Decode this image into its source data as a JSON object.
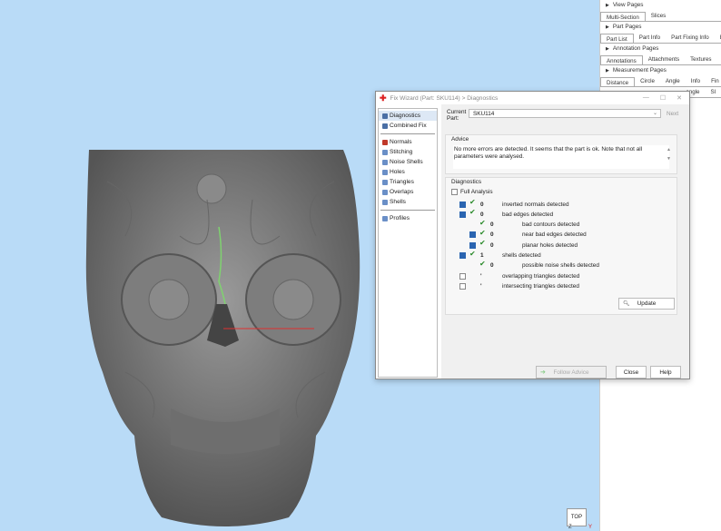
{
  "viewport": {
    "background": "#b9dbf7",
    "top_button": "TOP",
    "axis_z": "Z",
    "axis_y": "Y"
  },
  "right_panel": {
    "sections": [
      {
        "label": "View Pages",
        "tabs": [
          {
            "label": "Multi-Section",
            "active": true
          },
          {
            "label": "Slices",
            "active": false
          }
        ]
      },
      {
        "label": "Part Pages",
        "tabs": [
          {
            "label": "Part List",
            "active": true
          },
          {
            "label": "Part Info",
            "active": false
          },
          {
            "label": "Part Fixing Info",
            "active": false
          },
          {
            "label": "E",
            "active": false
          }
        ]
      },
      {
        "label": "Annotation Pages",
        "tabs": [
          {
            "label": "Annotations",
            "active": true
          },
          {
            "label": "Attachments",
            "active": false
          },
          {
            "label": "Textures",
            "active": false
          }
        ]
      },
      {
        "label": "Measurement Pages",
        "tabs": [
          {
            "label": "Distance",
            "active": true
          },
          {
            "label": "Circle",
            "active": false
          },
          {
            "label": "Angle",
            "active": false
          },
          {
            "label": "Info",
            "active": false
          },
          {
            "label": "Fin",
            "active": false
          }
        ]
      }
    ],
    "extra_tab_row": [
      {
        "label": "angle",
        "active": false
      },
      {
        "label": "Sl",
        "active": false
      }
    ]
  },
  "dialog": {
    "title": "Fix Wizard (Part: SKU114) > Diagnostics",
    "title_controls": [
      "—",
      "☐",
      "✕"
    ],
    "nav_top": [
      {
        "label": "Diagnostics",
        "color": "#4a6fa5",
        "selected": true
      },
      {
        "label": "Combined Fix",
        "color": "#4a6fa5",
        "selected": false
      }
    ],
    "nav_mid": [
      {
        "label": "Normals",
        "color": "#c0392b"
      },
      {
        "label": "Stitching",
        "color": "#6a8fc7"
      },
      {
        "label": "Noise Shells",
        "color": "#6a8fc7"
      },
      {
        "label": "Holes",
        "color": "#6a8fc7"
      },
      {
        "label": "Triangles",
        "color": "#6a8fc7"
      },
      {
        "label": "Overlaps",
        "color": "#6a8fc7"
      },
      {
        "label": "Shells",
        "color": "#6a8fc7"
      }
    ],
    "nav_bottom": [
      {
        "label": "Profiles",
        "color": "#6a8fc7"
      }
    ],
    "current_part_label": "Current Part:",
    "current_part_value": "SKU114",
    "next_label": "Next",
    "advice_title": "Advice",
    "advice_text": "No more errors are detected. It seems that the part is ok. Note that not all parameters were analysed.",
    "diagnostics_title": "Diagnostics",
    "full_analysis_label": "Full Analysis",
    "diagnostics": [
      {
        "indent": 0,
        "checked": true,
        "ok": true,
        "count": "0",
        "label": "inverted normals detected"
      },
      {
        "indent": 0,
        "checked": true,
        "ok": true,
        "count": "0",
        "label": "bad edges detected"
      },
      {
        "indent": 1,
        "checked": null,
        "ok": true,
        "count": "0",
        "label": "bad contours detected"
      },
      {
        "indent": 1,
        "checked": true,
        "ok": true,
        "count": "0",
        "label": "near bad edges detected"
      },
      {
        "indent": 1,
        "checked": true,
        "ok": true,
        "count": "0",
        "label": "planar holes detected"
      },
      {
        "indent": 0,
        "checked": true,
        "ok": true,
        "count": "1",
        "label": "shells detected"
      },
      {
        "indent": 1,
        "checked": null,
        "ok": true,
        "count": "0",
        "label": "possible noise shells detected"
      },
      {
        "indent": 0,
        "checked": false,
        "ok": false,
        "count": "'",
        "label": "overlapping triangles detected"
      },
      {
        "indent": 0,
        "checked": false,
        "ok": false,
        "count": "'",
        "label": "intersecting triangles detected"
      }
    ],
    "update_label": "Update",
    "follow_advice_label": "Follow Advice",
    "close_label": "Close",
    "help_label": "Help"
  }
}
